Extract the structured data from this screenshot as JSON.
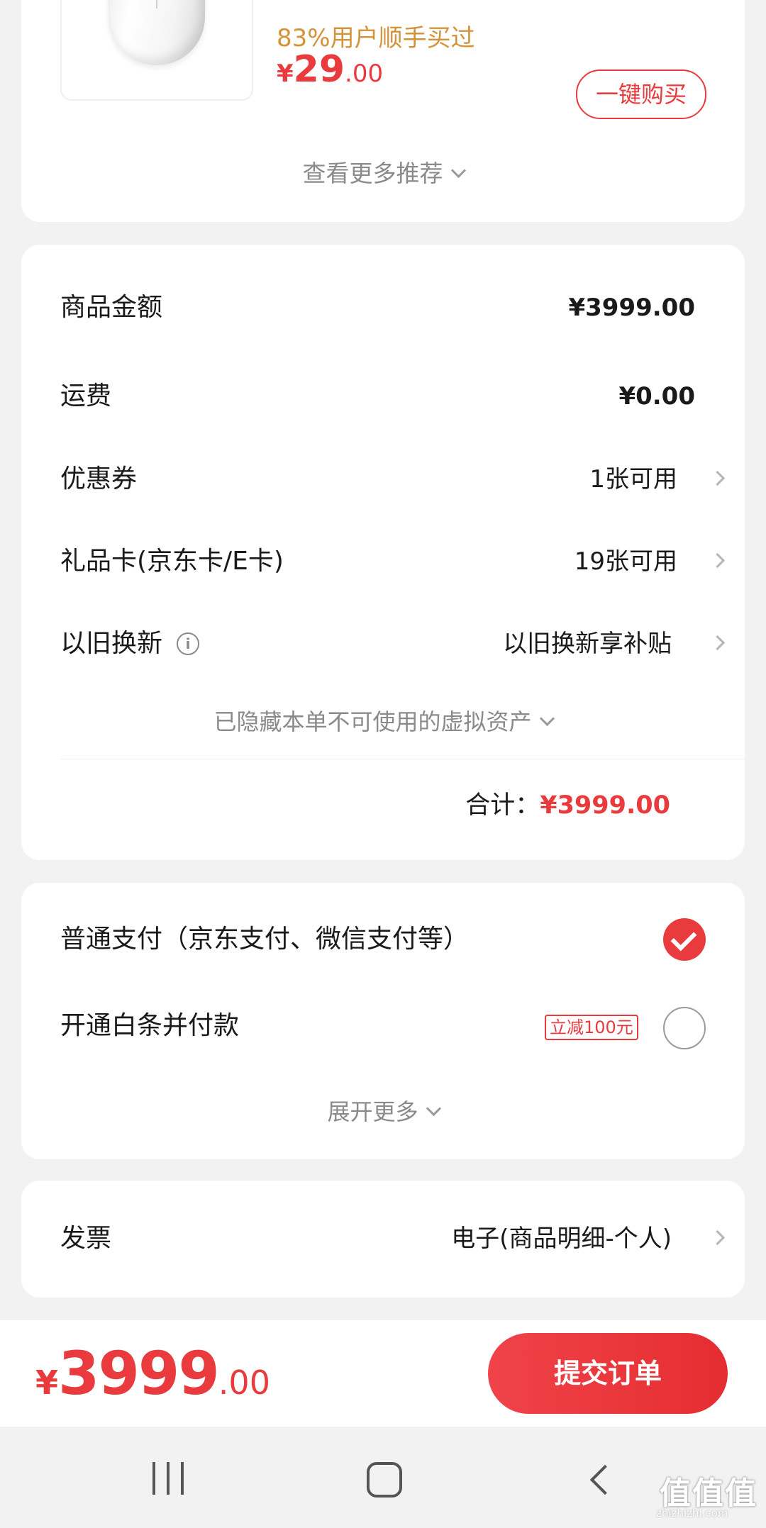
{
  "recommend": {
    "sold_text": "83%用户顺手买过",
    "price_symbol": "¥",
    "price_int": "29",
    "price_dec": ".00",
    "buy_button": "一键购买",
    "more_link": "查看更多推荐"
  },
  "summary": {
    "goods_amount_label": "商品金额",
    "goods_amount_value": "¥3999.00",
    "shipping_label": "运费",
    "shipping_value": "¥0.00",
    "coupon_label": "优惠券",
    "coupon_value": "1张可用",
    "giftcard_label": "礼品卡(京东卡/E卡)",
    "giftcard_value": "19张可用",
    "tradein_label": "以旧换新",
    "tradein_value": "以旧换新享补贴",
    "hidden_assets": "已隐藏本单不可使用的虚拟资产",
    "total_label": "合计：",
    "total_value": "¥3999.00"
  },
  "payment": {
    "normal_label": "普通支付（京东支付、微信支付等）",
    "normal_selected": true,
    "baitiao_label": "开通白条并付款",
    "baitiao_badge": "立减100元",
    "baitiao_selected": false,
    "expand_more": "展开更多"
  },
  "invoice": {
    "label": "发票",
    "value": "电子(商品明细-个人)"
  },
  "bottom_bar": {
    "price_symbol": "¥",
    "price_int": "3999",
    "price_dec": ".00",
    "submit_button": "提交订单"
  },
  "watermark": {
    "text": "值值值",
    "sub": "zhizhizhi.com"
  },
  "colors": {
    "accent": "#e93b3d",
    "sold_text": "#d4933a",
    "background": "#f2f2f2",
    "muted_text": "#8a8a8a"
  },
  "icons": {
    "chevron_down": "chevron-down-icon",
    "chevron_right": "chevron-right-icon",
    "info": "info-icon",
    "check": "check-icon",
    "nav_recent": "recent-apps-icon",
    "nav_home": "home-icon",
    "nav_back": "back-icon"
  }
}
